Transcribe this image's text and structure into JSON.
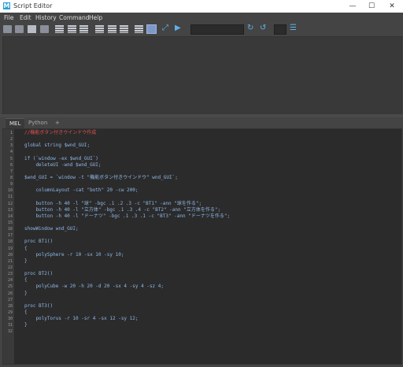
{
  "window": {
    "title": "Script Editor",
    "app_icon": "M",
    "minimize": "—",
    "maximize": "☐",
    "close": "✕"
  },
  "menu": [
    "File",
    "Edit",
    "History",
    "Command",
    "Help"
  ],
  "tabs": [
    {
      "label": "MEL",
      "active": true
    },
    {
      "label": "Python",
      "active": false
    },
    {
      "label": "+",
      "active": false
    }
  ],
  "toolbar_icons": [
    "open-script-icon",
    "load-script-icon",
    "save-script-icon",
    "save-to-shelf-icon",
    "clear-history-icon",
    "clear-input-icon",
    "clear-all-icon",
    "echo-all-icon",
    "show-line-numbers-icon",
    "show-stack-trace-icon",
    "execute-all-icon",
    "execute-icon",
    "run-icon",
    "search-field",
    "find-next-icon",
    "find-prev-icon",
    "goto-line-field",
    "goto-line-icon"
  ],
  "code_lines": [
    {
      "n": "1",
      "t": "//機能ボタン付きウインドウ作成",
      "c": "comment"
    },
    {
      "n": "2",
      "t": "",
      "c": "default"
    },
    {
      "n": "3",
      "t": "global string $wnd_GUI;",
      "c": "default"
    },
    {
      "n": "4",
      "t": "",
      "c": "default"
    },
    {
      "n": "5",
      "t": "if (`window -ex $wnd_GUI`)",
      "c": "default"
    },
    {
      "n": "6",
      "t": "    deleteUI -wnd $wnd_GUI;",
      "c": "default"
    },
    {
      "n": "7",
      "t": "",
      "c": "default"
    },
    {
      "n": "8",
      "t": "$wnd_GUI = `window -t \"機能ボタン付きウインドウ\" wnd_GUI`;",
      "c": "default"
    },
    {
      "n": "9",
      "t": "",
      "c": "default"
    },
    {
      "n": "10",
      "t": "    columnLayout -cat \"both\" 20 -cw 200;",
      "c": "default"
    },
    {
      "n": "11",
      "t": "",
      "c": "default"
    },
    {
      "n": "12",
      "t": "    button -h 40 -l \"球\" -bgc .1 .2 .3 -c \"BT1\" -ann \"球を作る\";",
      "c": "default"
    },
    {
      "n": "13",
      "t": "    button -h 40 -l \"立方体\" -bgc .1 .3 .4 -c \"BT2\" -ann \"立方体を作る\";",
      "c": "default"
    },
    {
      "n": "14",
      "t": "    button -h 40 -l \"ドーナツ\" -bgc .1 .3 .1 -c \"BT3\" -ann \"ドーナツを作る\";",
      "c": "default"
    },
    {
      "n": "15",
      "t": "",
      "c": "default"
    },
    {
      "n": "16",
      "t": "showWindow wnd_GUI;",
      "c": "default"
    },
    {
      "n": "17",
      "t": "",
      "c": "default"
    },
    {
      "n": "18",
      "t": "proc BT1()",
      "c": "default"
    },
    {
      "n": "19",
      "t": "{",
      "c": "default"
    },
    {
      "n": "20",
      "t": "    polySphere -r 10 -sx 10 -sy 10;",
      "c": "default"
    },
    {
      "n": "21",
      "t": "}",
      "c": "default"
    },
    {
      "n": "22",
      "t": "",
      "c": "default"
    },
    {
      "n": "23",
      "t": "proc BT2()",
      "c": "default"
    },
    {
      "n": "24",
      "t": "{",
      "c": "default"
    },
    {
      "n": "25",
      "t": "    polyCube -w 20 -h 20 -d 20 -sx 4 -sy 4 -sz 4;",
      "c": "default"
    },
    {
      "n": "26",
      "t": "}",
      "c": "default"
    },
    {
      "n": "27",
      "t": "",
      "c": "default"
    },
    {
      "n": "28",
      "t": "proc BT3()",
      "c": "default"
    },
    {
      "n": "29",
      "t": "{",
      "c": "default"
    },
    {
      "n": "30",
      "t": "    polyTorus -r 10 -sr 4 -sx 12 -sy 12;",
      "c": "default"
    },
    {
      "n": "31",
      "t": "}",
      "c": "default"
    },
    {
      "n": "32",
      "t": "",
      "c": "default"
    }
  ],
  "colors": {
    "comment": "#e05050",
    "code": "#8fb8e8",
    "editor_bg": "#2b2b2b",
    "panel_bg": "#444444"
  }
}
